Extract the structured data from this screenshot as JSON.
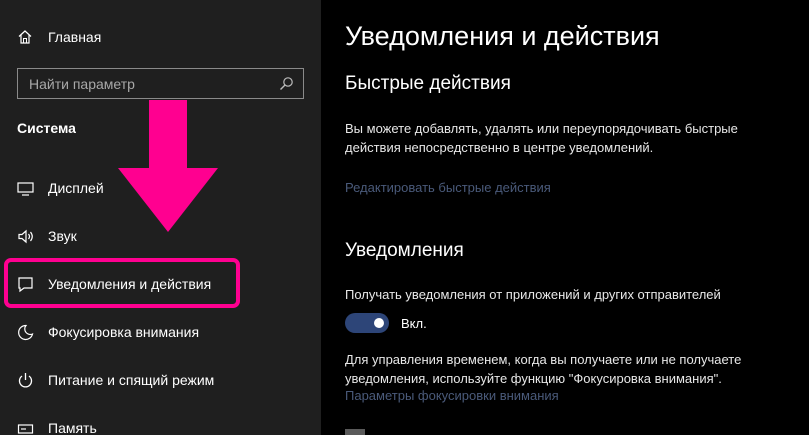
{
  "sidebar": {
    "home_label": "Главная",
    "search_placeholder": "Найти параметр",
    "section_title": "Система",
    "items": [
      {
        "label": "Дисплей",
        "icon": "display-icon"
      },
      {
        "label": "Звук",
        "icon": "speaker-icon"
      },
      {
        "label": "Уведомления и действия",
        "icon": "notification-icon"
      },
      {
        "label": "Фокусировка внимания",
        "icon": "moon-icon"
      },
      {
        "label": "Питание и спящий режим",
        "icon": "power-icon"
      },
      {
        "label": "Память",
        "icon": "storage-icon"
      }
    ]
  },
  "annotation": {
    "color": "#ff0090"
  },
  "main": {
    "title": "Уведомления и действия",
    "quick_actions": {
      "heading": "Быстрые действия",
      "description": "Вы можете добавлять, удалять или переупорядочивать быстрые действия непосредственно в центре уведомлений.",
      "link": "Редактировать быстрые действия"
    },
    "notifications": {
      "heading": "Уведомления",
      "toggle_caption": "Получать уведомления от приложений и других отправителей",
      "toggle_state": "Вкл.",
      "toggle_on": true,
      "focus_note": "Для управления временем, когда вы получаете или не получаете уведомления, используйте функцию \"Фокусировка внимания\".",
      "focus_link": "Параметры фокусировки внимания"
    }
  },
  "colors": {
    "accent": "#2d4578",
    "link": "#4a5a7a",
    "sidebar_bg": "#1f1f1f",
    "main_bg": "#000000"
  }
}
